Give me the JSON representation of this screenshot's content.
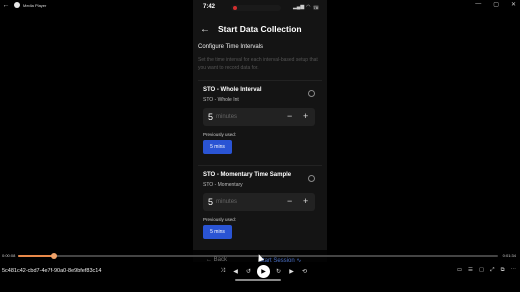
{
  "window": {
    "title": "Media Player",
    "controls": [
      "—",
      "▢",
      "✕"
    ]
  },
  "phone": {
    "status": {
      "time": "7:42",
      "battery": "78"
    },
    "header": {
      "title": "Start Data Collection"
    },
    "section": {
      "title": "Configure Time Intervals",
      "description": "Set the time interval for each interval-based setup that you want to record data for."
    },
    "cards": [
      {
        "title": "STO - Whole Interval",
        "subtitle": "STO - Whole Int",
        "value": "5",
        "unit": "minutes",
        "previous_label": "Previously used:",
        "previous_chip": "5 mins"
      },
      {
        "title": "STO - Momentary Time Sample",
        "subtitle": "STO - Momentary",
        "value": "5",
        "unit": "minutes",
        "previous_label": "Previously used:",
        "previous_chip": "5 mins"
      }
    ],
    "bottom": {
      "back": "Back",
      "start": "Start Session"
    }
  },
  "player": {
    "time_left": "0:00:08",
    "time_right": "0:01:34",
    "progress": 0.075,
    "media_name": "5c481c42-cbd7-4e7f-90a0-8e9bfef83c14"
  }
}
